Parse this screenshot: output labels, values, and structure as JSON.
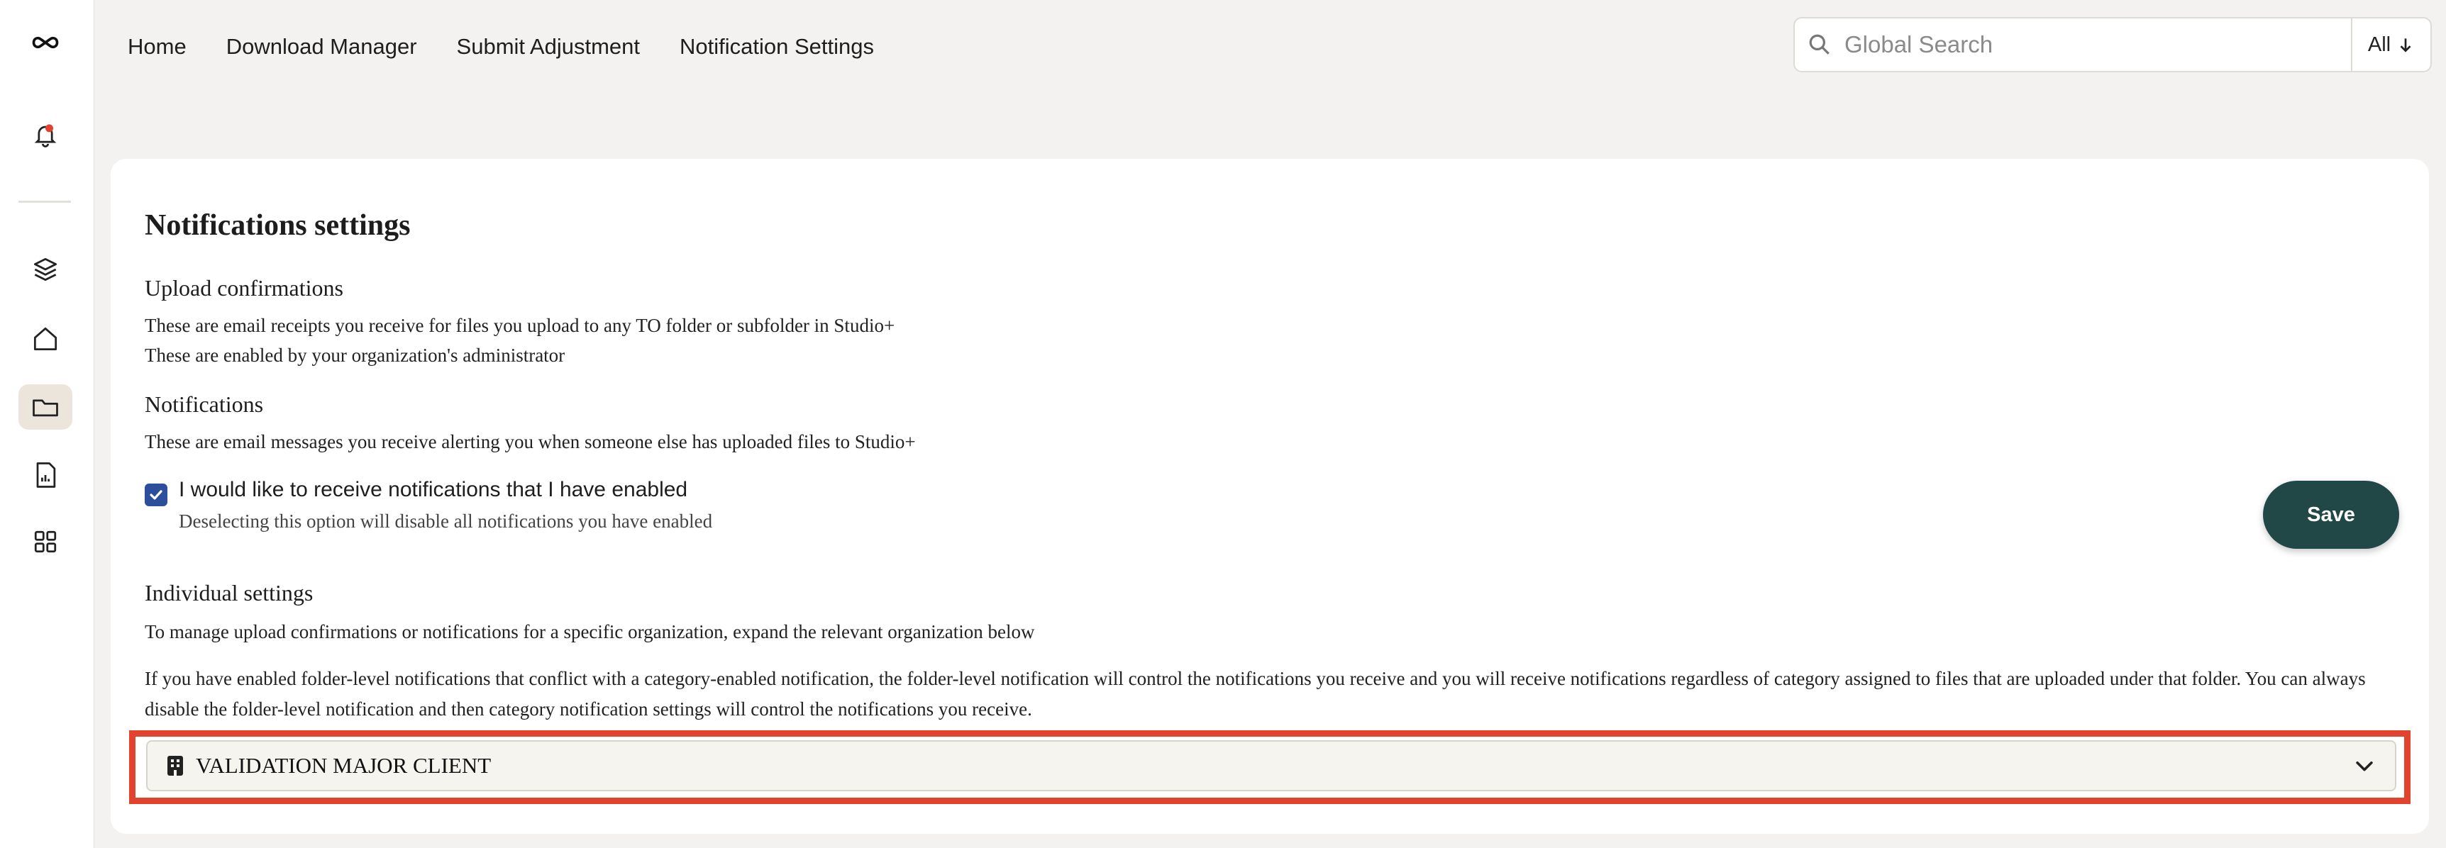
{
  "nav": {
    "items": [
      {
        "label": "Home"
      },
      {
        "label": "Download Manager"
      },
      {
        "label": "Submit Adjustment"
      },
      {
        "label": "Notification Settings"
      }
    ]
  },
  "search": {
    "placeholder": "Global Search",
    "scope_label": "All"
  },
  "sidebar": {
    "icons": [
      "logo-icon",
      "bell-icon",
      "layers-icon",
      "home-icon",
      "folder-icon",
      "report-icon",
      "grid-icon"
    ],
    "active": "folder-icon",
    "notification_dot_color": "#e2432e"
  },
  "settings": {
    "title": "Notifications settings",
    "upload_heading": "Upload confirmations",
    "upload_desc1": "These are email receipts you receive for files you upload to any TO folder or subfolder in Studio+",
    "upload_desc2": "These are enabled by your organization's administrator",
    "notif_heading": "Notifications",
    "notif_desc": "These are email messages you receive alerting you when someone else has uploaded files to Studio+",
    "checkbox_label": "I would like to receive notifications that I have enabled",
    "checkbox_checked": true,
    "checkbox_hint": "Deselecting this option will disable all notifications you have enabled",
    "save_label": "Save",
    "individual_heading": "Individual settings",
    "individual_desc": "To manage upload confirmations or notifications for a specific organization, expand the relevant organization below",
    "conflict_desc": "If you have enabled folder-level notifications that conflict with a category-enabled notification, the folder-level notification will control the notifications you receive and you will receive notifications regardless of category assigned to files that are uploaded under that folder. You can always disable the folder-level notification and then category notification settings will control the notifications you receive.",
    "org_name": "VALIDATION MAJOR CLIENT"
  },
  "colors": {
    "accent": "#214746",
    "checkbox": "#2d4f9b",
    "highlight": "#e2432e"
  }
}
